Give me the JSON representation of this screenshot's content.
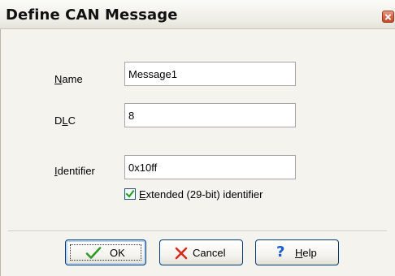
{
  "window": {
    "title": "Define CAN Message"
  },
  "form": {
    "name": {
      "label": "Name",
      "mnemonic": "N",
      "value": "Message1"
    },
    "dlc": {
      "label": "DLC",
      "mnemonic": "L",
      "value": "8"
    },
    "identifier": {
      "label": "Identifier",
      "mnemonic": "I",
      "value": "0x10ff"
    },
    "extended": {
      "label": "Extended (29-bit) identifier",
      "mnemonic": "E",
      "checked": true
    }
  },
  "buttons": {
    "ok": {
      "label": "OK",
      "icon": "checkmark-icon"
    },
    "cancel": {
      "label": "Cancel",
      "icon": "x-icon"
    },
    "help": {
      "label": "Help",
      "mnemonic": "H",
      "icon": "question-icon"
    }
  },
  "colors": {
    "ok_icon": "#2f9a26",
    "cancel_icon": "#d22d1f",
    "help_icon": "#1d5fd1",
    "checkbox_mark": "#21a121"
  }
}
